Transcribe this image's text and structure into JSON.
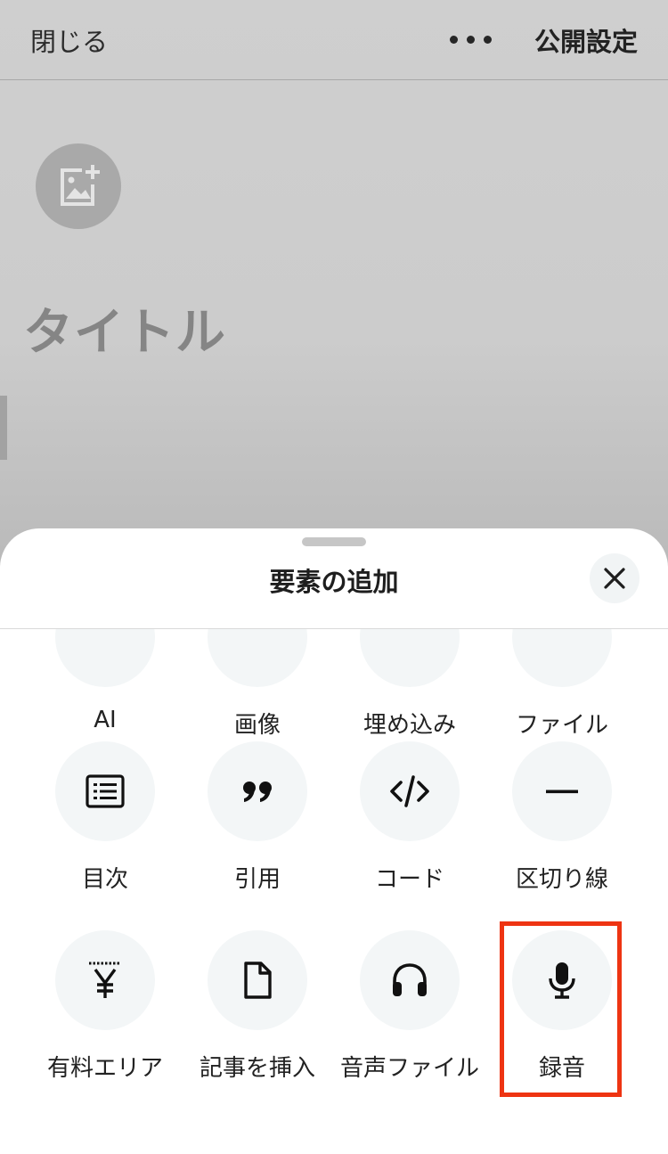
{
  "header": {
    "close_label": "閉じる",
    "publish_label": "公開設定",
    "more_icon": "more-horizontal-icon"
  },
  "editor": {
    "title_placeholder": "タイトル",
    "image_add_icon": "image-add-icon"
  },
  "sheet": {
    "title": "要素の追加",
    "close_icon": "close-icon",
    "rows": [
      [
        {
          "label": "AI"
        },
        {
          "label": "画像"
        },
        {
          "label": "埋め込み"
        },
        {
          "label": "ファイル"
        }
      ],
      [
        {
          "label": "目次",
          "icon": "list-icon"
        },
        {
          "label": "引用",
          "icon": "quote-icon"
        },
        {
          "label": "コード",
          "icon": "code-icon"
        },
        {
          "label": "区切り線",
          "icon": "divider-line-icon"
        }
      ],
      [
        {
          "label": "有料エリア",
          "icon": "yen-icon"
        },
        {
          "label": "記事を挿入",
          "icon": "document-icon"
        },
        {
          "label": "音声ファイル",
          "icon": "headphones-icon"
        },
        {
          "label": "録音",
          "icon": "microphone-icon"
        }
      ]
    ]
  },
  "colors": {
    "highlight": "#ee3412",
    "icon_bg": "#f3f6f7",
    "overlay": "#cccccc"
  }
}
